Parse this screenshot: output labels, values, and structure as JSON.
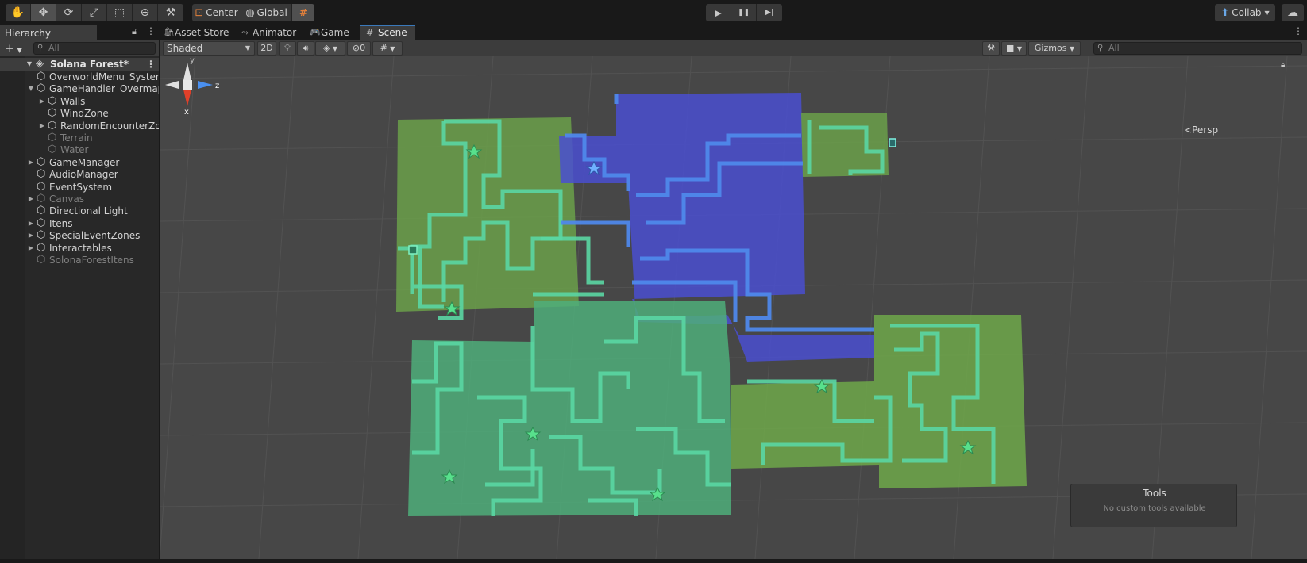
{
  "toolbar": {
    "tools": [
      {
        "name": "hand-tool",
        "icon": "✋"
      },
      {
        "name": "move-tool",
        "icon": "✥"
      },
      {
        "name": "rotate-tool",
        "icon": "⟳"
      },
      {
        "name": "scale-tool",
        "icon": "⤢"
      },
      {
        "name": "rect-tool",
        "icon": "⬚"
      },
      {
        "name": "transform-tool",
        "icon": "⊕"
      },
      {
        "name": "custom-tool",
        "icon": "⚒"
      }
    ],
    "pivot_label": "Center",
    "handle_label": "Global",
    "grid_icon": "#",
    "play_icon": "▶",
    "pause_icon": "❚❚",
    "step_icon": "▶|",
    "collab_label": "Collab",
    "cloud_icon": "☁"
  },
  "hierarchy": {
    "tab_label": "Hierarchy",
    "add_icon": "+",
    "search_placeholder": "All",
    "scene_name": "Solana Forest*",
    "items": [
      {
        "label": "OverworldMenu_System",
        "depth": 1,
        "arrow": "",
        "dim": false
      },
      {
        "label": "GameHandler_Overmap",
        "depth": 1,
        "arrow": "▼",
        "dim": false
      },
      {
        "label": "Walls",
        "depth": 2,
        "arrow": "▶",
        "dim": false
      },
      {
        "label": "WindZone",
        "depth": 2,
        "arrow": "",
        "dim": false
      },
      {
        "label": "RandomEncounterZone",
        "depth": 2,
        "arrow": "▶",
        "dim": false
      },
      {
        "label": "Terrain",
        "depth": 2,
        "arrow": "",
        "dim": true
      },
      {
        "label": "Water",
        "depth": 2,
        "arrow": "",
        "dim": true
      },
      {
        "label": "GameManager",
        "depth": 1,
        "arrow": "▶",
        "dim": false
      },
      {
        "label": "AudioManager",
        "depth": 1,
        "arrow": "",
        "dim": false
      },
      {
        "label": "EventSystem",
        "depth": 1,
        "arrow": "",
        "dim": false
      },
      {
        "label": "Canvas",
        "depth": 1,
        "arrow": "▶",
        "dim": true
      },
      {
        "label": "Directional Light",
        "depth": 1,
        "arrow": "",
        "dim": false
      },
      {
        "label": "Itens",
        "depth": 1,
        "arrow": "▶",
        "dim": false
      },
      {
        "label": "SpecialEventZones",
        "depth": 1,
        "arrow": "▶",
        "dim": false
      },
      {
        "label": "Interactables",
        "depth": 1,
        "arrow": "▶",
        "dim": false
      },
      {
        "label": "SolonaForestItens",
        "depth": 1,
        "arrow": "",
        "dim": true
      }
    ]
  },
  "scene_view": {
    "tabs": [
      {
        "label": "Asset Store",
        "icon": "🛍"
      },
      {
        "label": "Animator",
        "icon": "⤳"
      },
      {
        "label": "Game",
        "icon": "🎮"
      },
      {
        "label": "Scene",
        "icon": "#"
      }
    ],
    "active_tab": "Scene",
    "shading_mode": "Shaded",
    "mode_2d": "2D",
    "hidden_count": "0",
    "gizmos_label": "Gizmos",
    "search_placeholder": "All",
    "projection_label": "Persp",
    "axis_y": "y",
    "axis_z": "z",
    "axis_x": "x",
    "colors": {
      "green_zone": "#6fa84a",
      "teal_zone": "#4fae7a",
      "blue_zone": "#4a4fd0",
      "wall_green": "#5ad6a3",
      "wall_blue": "#4f88ea",
      "background": "#474747"
    }
  },
  "tools_overlay": {
    "title": "Tools",
    "message": "No custom tools available"
  }
}
